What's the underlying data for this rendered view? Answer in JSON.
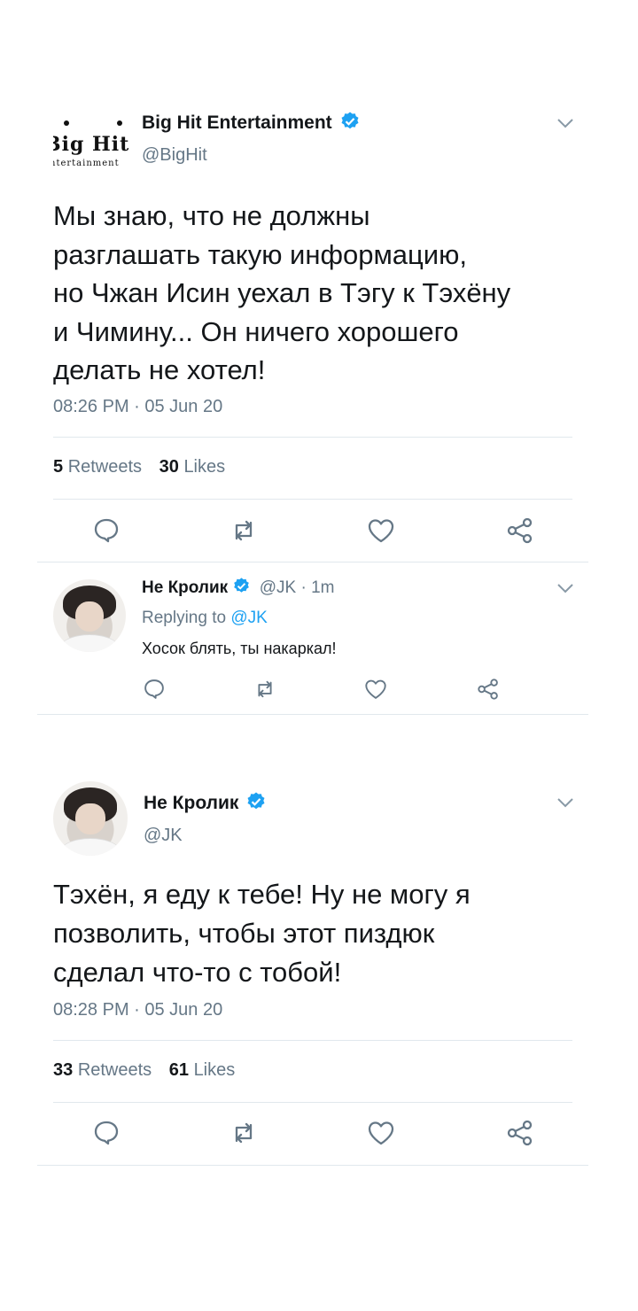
{
  "tweet1": {
    "logo_text": "Big Hit",
    "logo_sub": "ntertainment",
    "display_name": "Big Hit Entertainment",
    "handle": "@BigHit",
    "body_lines": [
      "Мы знаю, что не должны",
      "разглашать такую информацию,",
      "но Чжан Исин уехал в Тэгу к Тэхёну",
      "и Чимину... Он ничего хорошего",
      "делать не хотел!"
    ],
    "timestamp": "08:26 PM · 05 Jun 20",
    "retweets_count": "5",
    "retweets_label": "Retweets",
    "likes_count": "30",
    "likes_label": "Likes"
  },
  "reply": {
    "display_name": "Не Кролик",
    "handle_time": "@JK · 1m",
    "replying_prefix": "Replying to",
    "replying_handle": "@JK",
    "text": "Хосок блять, ты накаркал!"
  },
  "tweet2": {
    "display_name": "Не Кролик",
    "handle": "@JK",
    "body_lines": [
      "Тэхён, я еду к тебе! Ну не могу я",
      "позволить, чтобы этот пиздюк",
      "сделал что-то с тобой!"
    ],
    "timestamp": "08:28 PM · 05 Jun 20",
    "retweets_count": "33",
    "retweets_label": "Retweets",
    "likes_count": "61",
    "likes_label": "Likes"
  },
  "icons": [
    "reply-icon",
    "retweet-icon",
    "like-icon",
    "share-icon",
    "verified-badge-icon",
    "chevron-down-icon"
  ],
  "colors": {
    "accent": "#1da1f2",
    "text": "#14171a",
    "secondary": "#657786",
    "divider": "#e1e8ed"
  }
}
